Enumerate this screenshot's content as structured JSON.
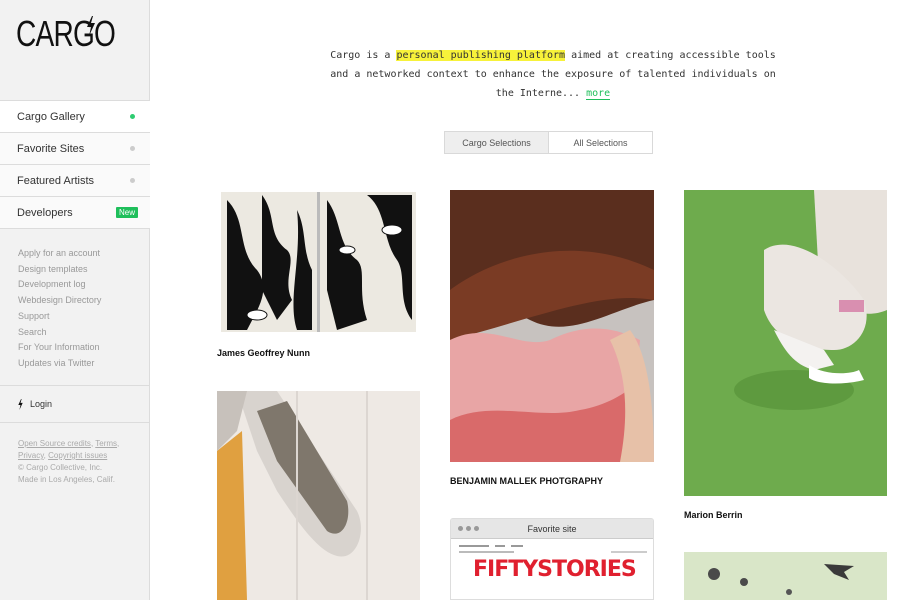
{
  "brand": {
    "logo_text": "CARGO"
  },
  "sidebar": {
    "nav": [
      {
        "label": "Cargo Gallery",
        "indicator": "dot-active"
      },
      {
        "label": "Favorite Sites",
        "indicator": "dot"
      },
      {
        "label": "Featured Artists",
        "indicator": "dot"
      },
      {
        "label": "Developers",
        "badge": "New"
      }
    ],
    "links": [
      "Apply for an account",
      "Design templates",
      "Development log",
      "Webdesign Directory",
      "Support",
      "Search",
      "For Your Information",
      "Updates via Twitter"
    ],
    "login_label": "Login",
    "legal": {
      "open_source": "Open Source credits",
      "terms": "Terms",
      "privacy": "Privacy",
      "copyright": "Copyright issues",
      "company": "© Cargo Collective, Inc.",
      "made_in": "Made in Los Angeles, Calif."
    }
  },
  "intro": {
    "prefix": "Cargo is a",
    "highlight": "personal publishing platform",
    "rest": "aimed at creating accessible tools and a networked context to enhance the exposure of talented individuals on the Interne...",
    "more_label": "more"
  },
  "tabs": [
    {
      "label": "Cargo Selections",
      "selected": true
    },
    {
      "label": "All Selections",
      "selected": false
    }
  ],
  "gallery": [
    {
      "caption": "James Geoffrey Nunn"
    },
    {
      "caption": "BENJAMIN MALLEK PHOTGRAPHY"
    },
    {
      "caption": "Marion Berrin"
    },
    {
      "caption": ""
    },
    {
      "window_title": "Favorite site",
      "big_text": "FIFTYSTORIES"
    }
  ],
  "colors": {
    "accent": "#1fbf5b",
    "highlight": "#f7f23a"
  }
}
